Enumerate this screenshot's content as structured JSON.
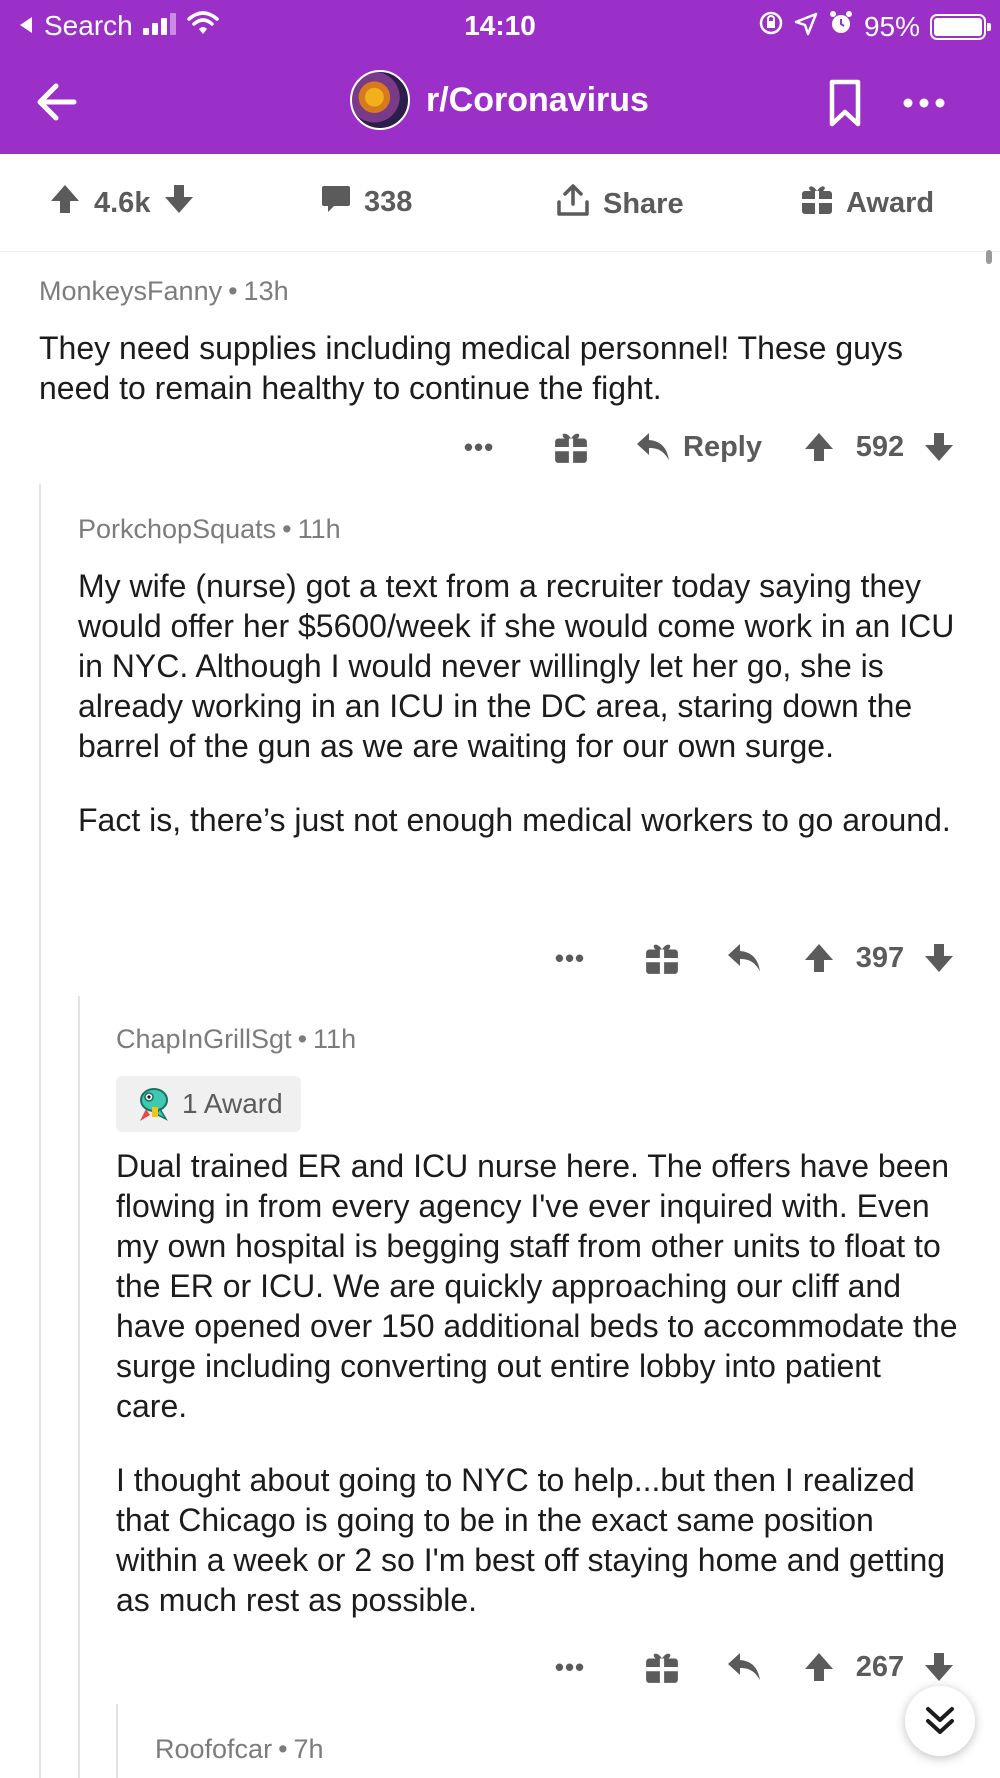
{
  "status_bar": {
    "back_to_app": "Search",
    "time": "14:10",
    "battery": "95%",
    "icons": [
      "back-triangle-icon",
      "signal-icon",
      "wifi-icon",
      "orientation-lock-icon",
      "location-icon",
      "alarm-icon",
      "battery-icon"
    ]
  },
  "nav": {
    "subreddit": "r/Coronavirus",
    "icons": [
      "back-arrow-icon",
      "subreddit-avatar",
      "bookmark-icon",
      "more-icon"
    ]
  },
  "post_actions": {
    "score": "4.6k",
    "comments": "338",
    "share": "Share",
    "award": "Award"
  },
  "comments": [
    {
      "author": "MonkeysFanny",
      "age": "13h",
      "body": [
        "They need supplies including medical personnel!  These guys need to remain healthy to continue the fight."
      ],
      "reply_label": "Reply",
      "score": "592"
    },
    {
      "author": "PorkchopSquats",
      "age": "11h",
      "body": [
        "My wife (nurse) got a text from a recruiter today saying they would offer her $5600/week if she would come work in an ICU in NYC.  Although I would never willingly let her go, she is already working in an ICU in the DC area, staring down the barrel of the gun as we are waiting for our own surge.",
        "Fact is, there’s just not enough medical workers to go around."
      ],
      "score": "397"
    },
    {
      "author": "ChapInGrillSgt",
      "age": "11h",
      "award": "1 Award",
      "body": [
        "Dual trained ER and ICU nurse here. The offers have been flowing in from every agency I've ever inquired with. Even my own hospital is begging staff from other units to float to the ER or ICU. We are quickly approaching our cliff and have opened over 150 additional beds to accommodate the surge including converting out entire lobby into patient care.",
        "I thought about going to NYC to help...but then I realized that Chicago is going to be in the exact same position within a week or 2 so I'm best off staying home and getting as much rest as possible."
      ],
      "score": "267"
    },
    {
      "author": "Roofofcar",
      "age": "7h"
    }
  ],
  "colors": {
    "header_bg": "#9b30c8",
    "text": "#1c1c1c",
    "meta_text": "#7c7c7c",
    "icon_gray": "#5b5b5b"
  }
}
